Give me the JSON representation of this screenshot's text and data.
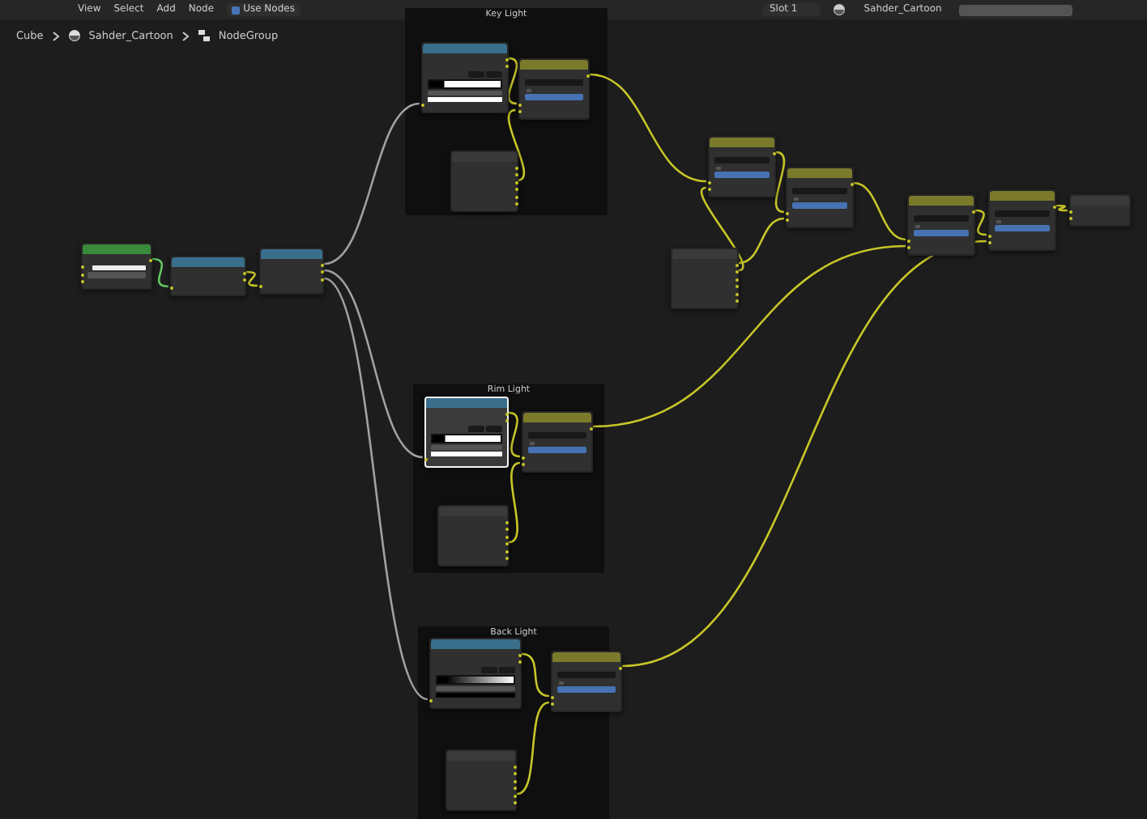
{
  "header": {
    "menus": [
      "View",
      "Select",
      "Add",
      "Node"
    ],
    "use_nodes": {
      "label": "Use Nodes",
      "checked": true
    },
    "slot": "Slot 1",
    "material": "Sahder_Cartoon"
  },
  "breadcrumb": [
    "Cube",
    "Sahder_Cartoon",
    "NodeGroup"
  ],
  "frames": [
    {
      "label": "Key Light"
    },
    {
      "label": "Rim Light"
    },
    {
      "label": "Back Light"
    }
  ],
  "nodes": [
    {
      "kind": "shader",
      "selected": false,
      "rows": [
        {
          "kind": "out"
        },
        {
          "kind": "field"
        },
        {
          "kind": "value"
        },
        {
          "kind": "in"
        }
      ]
    },
    {
      "kind": "converter",
      "selected": false,
      "rows": [
        {
          "kind": "out"
        },
        {
          "kind": "out"
        },
        {
          "kind": "in"
        }
      ]
    },
    {
      "kind": "converter",
      "selected": false,
      "rows": [
        {
          "kind": "out"
        },
        {
          "kind": "out"
        },
        {
          "kind": "out"
        },
        {
          "kind": "in"
        }
      ]
    },
    {
      "kind": "converter",
      "selected": false,
      "rows": [
        {
          "kind": "out"
        },
        {
          "kind": "out"
        },
        {
          "kind": "ramp_hard"
        },
        {
          "kind": "in"
        }
      ]
    },
    {
      "kind": "color",
      "selected": false,
      "rows": [
        {
          "kind": "out"
        },
        {
          "kind": "dropdown"
        },
        {
          "kind": "check",
          "checked": false
        },
        {
          "kind": "factor"
        },
        {
          "kind": "in"
        },
        {
          "kind": "in"
        }
      ]
    },
    {
      "kind": "group",
      "selected": false,
      "rows": [
        {
          "kind": "out"
        },
        {
          "kind": "out"
        },
        {
          "kind": "out"
        },
        {
          "kind": "out"
        },
        {
          "kind": "out"
        },
        {
          "kind": "out"
        }
      ]
    },
    {
      "kind": "converter",
      "selected": true,
      "rows": [
        {
          "kind": "out"
        },
        {
          "kind": "out"
        },
        {
          "kind": "ramp_white"
        },
        {
          "kind": "in"
        }
      ]
    },
    {
      "kind": "color",
      "selected": false,
      "rows": [
        {
          "kind": "out"
        },
        {
          "kind": "dropdown"
        },
        {
          "kind": "check",
          "checked": false
        },
        {
          "kind": "factor"
        },
        {
          "kind": "in"
        },
        {
          "kind": "in"
        }
      ]
    },
    {
      "kind": "group",
      "selected": false,
      "rows": [
        {
          "kind": "out"
        },
        {
          "kind": "out"
        },
        {
          "kind": "out"
        },
        {
          "kind": "out"
        },
        {
          "kind": "out"
        },
        {
          "kind": "out"
        }
      ]
    },
    {
      "kind": "converter",
      "selected": false,
      "rows": [
        {
          "kind": "out"
        },
        {
          "kind": "out"
        },
        {
          "kind": "ramp_smooth"
        },
        {
          "kind": "in"
        }
      ]
    },
    {
      "kind": "color",
      "selected": false,
      "rows": [
        {
          "kind": "out"
        },
        {
          "kind": "dropdown"
        },
        {
          "kind": "check",
          "checked": false
        },
        {
          "kind": "factor"
        },
        {
          "kind": "in"
        },
        {
          "kind": "in"
        }
      ]
    },
    {
      "kind": "group",
      "selected": false,
      "rows": [
        {
          "kind": "out"
        },
        {
          "kind": "out"
        },
        {
          "kind": "out"
        },
        {
          "kind": "out"
        },
        {
          "kind": "out"
        },
        {
          "kind": "out"
        }
      ]
    },
    {
      "kind": "color",
      "selected": false,
      "rows": [
        {
          "kind": "out"
        },
        {
          "kind": "dropdown"
        },
        {
          "kind": "check",
          "checked": false
        },
        {
          "kind": "factor"
        },
        {
          "kind": "in"
        },
        {
          "kind": "in"
        }
      ]
    },
    {
      "kind": "group",
      "selected": false,
      "rows": [
        {
          "kind": "out"
        },
        {
          "kind": "out"
        },
        {
          "kind": "out"
        },
        {
          "kind": "out"
        },
        {
          "kind": "out"
        },
        {
          "kind": "out"
        }
      ]
    },
    {
      "kind": "color",
      "selected": false,
      "rows": [
        {
          "kind": "out"
        },
        {
          "kind": "dropdown"
        },
        {
          "kind": "check",
          "checked": false
        },
        {
          "kind": "factor"
        },
        {
          "kind": "in"
        },
        {
          "kind": "in"
        }
      ]
    },
    {
      "kind": "color",
      "selected": false,
      "rows": [
        {
          "kind": "out"
        },
        {
          "kind": "dropdown"
        },
        {
          "kind": "check",
          "checked": false
        },
        {
          "kind": "factor"
        },
        {
          "kind": "in"
        },
        {
          "kind": "in"
        }
      ]
    },
    {
      "kind": "color",
      "selected": false,
      "rows": [
        {
          "kind": "out"
        },
        {
          "kind": "dropdown"
        },
        {
          "kind": "check",
          "checked": false
        },
        {
          "kind": "factor"
        },
        {
          "kind": "in"
        },
        {
          "kind": "in"
        }
      ]
    },
    {
      "kind": "group",
      "selected": false,
      "rows": [
        {
          "kind": "in"
        },
        {
          "kind": "in"
        }
      ]
    }
  ]
}
